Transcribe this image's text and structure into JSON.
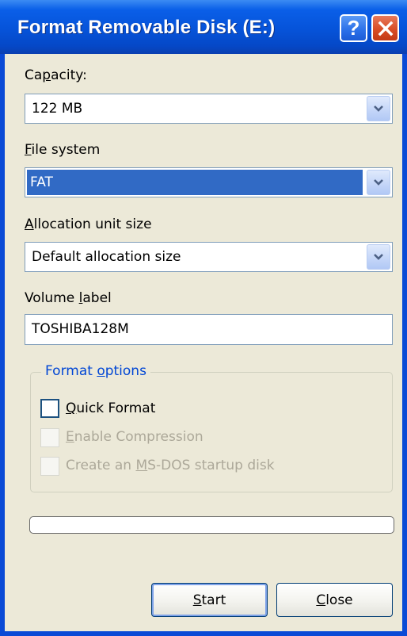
{
  "window": {
    "title": "Format Removable Disk (E:)",
    "help_glyph": "?"
  },
  "capacity": {
    "label_pre": "Ca",
    "label_accel": "p",
    "label_post": "acity:",
    "value": "122 MB"
  },
  "file_system": {
    "label_pre": "",
    "label_accel": "F",
    "label_post": "ile system",
    "value": "FAT"
  },
  "allocation": {
    "label_pre": "",
    "label_accel": "A",
    "label_post": "llocation unit size",
    "value": "Default allocation size"
  },
  "volume_label": {
    "label_pre": "Volume ",
    "label_accel": "l",
    "label_post": "abel",
    "value": "TOSHIBA128M"
  },
  "format_options": {
    "legend_pre": "Format ",
    "legend_accel": "o",
    "legend_post": "ptions",
    "quick": {
      "pre": "",
      "accel": "Q",
      "post": "uick Format",
      "checked": false,
      "enabled": true
    },
    "compression": {
      "pre": "",
      "accel": "E",
      "post": "nable Compression",
      "checked": false,
      "enabled": false
    },
    "msdos": {
      "pre": "Create an ",
      "accel": "M",
      "post": "S-DOS startup disk",
      "checked": false,
      "enabled": false
    }
  },
  "progress": {
    "value": 0
  },
  "buttons": {
    "start": {
      "pre": "",
      "accel": "S",
      "post": "tart"
    },
    "close": {
      "pre": "",
      "accel": "C",
      "post": "lose"
    }
  },
  "colors": {
    "title_bar": "#0653d9",
    "selection": "#316ac5",
    "legend": "#0046d5",
    "disabled_text": "#aca899"
  }
}
